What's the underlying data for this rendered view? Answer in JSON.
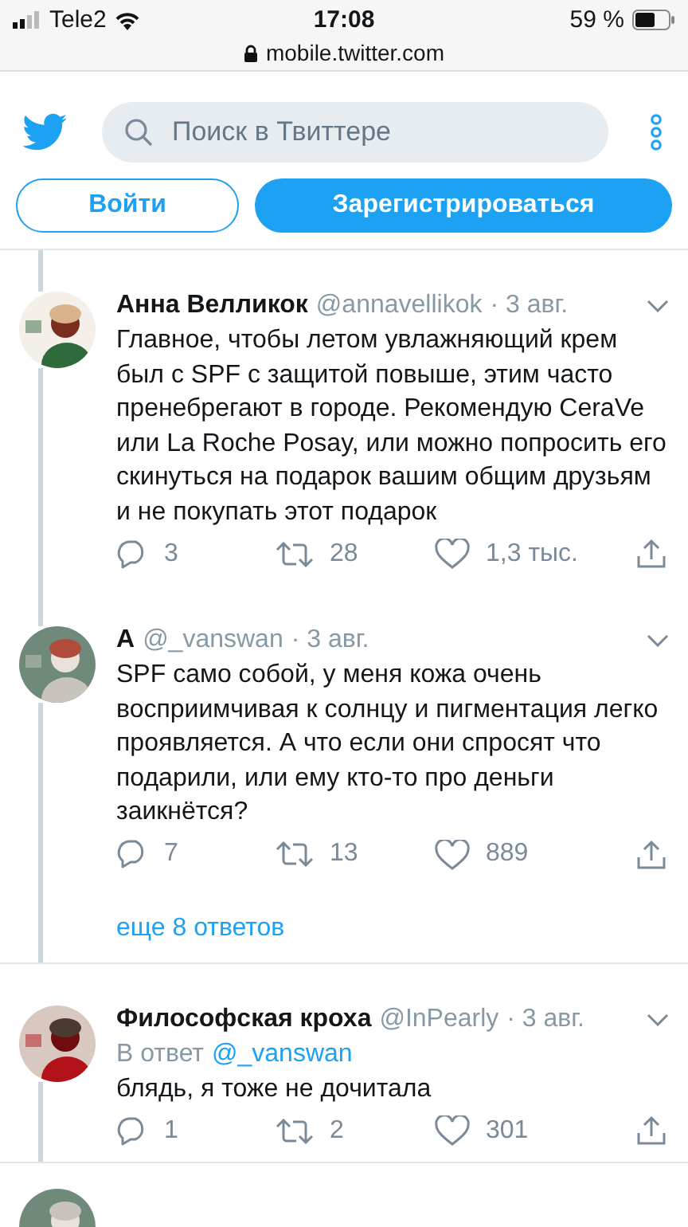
{
  "status_bar": {
    "carrier": "Tele2",
    "time": "17:08",
    "battery": "59 %",
    "url": "mobile.twitter.com"
  },
  "search": {
    "placeholder": "Поиск в Твиттере"
  },
  "buttons": [
    {
      "label": "Войти",
      "kind": "outline"
    },
    {
      "label": "Зарегистрироваться",
      "kind": "filled"
    }
  ],
  "tweets": [
    {
      "name": "Анна Велликок",
      "handle": "@annavellikok",
      "date": "· 3 авг.",
      "text": "Главное, чтобы летом увлажняющий крем был с SPF с защитой повыше, этим часто пренебрегают в городе. Рекомендую CeraVe или La Roche Posay, или можно попросить его скинуться на подарок вашим общим друзьям и не покупать этот подарок",
      "replies": "3",
      "retweets": "28",
      "likes": "1,3 тыс."
    },
    {
      "name": "А",
      "handle": "@_vanswan",
      "date": "· 3 авг.",
      "text": "SPF само собой, у меня кожа очень восприимчивая к солнцу и пигментация легко проявляется. А что если они спросят что подарили, или ему кто-то про деньги заикнётся?",
      "replies": "7",
      "retweets": "13",
      "likes": "889",
      "more_replies": "еще 8 ответов"
    },
    {
      "name": "Философская кроха",
      "handle": "@InPearly",
      "date": "· 3 авг.",
      "reply_to": {
        "prefix": "В ответ",
        "handle": "@_vanswan"
      },
      "text": "блядь, я тоже не дочитала",
      "replies": "1",
      "retweets": "2",
      "likes": "301"
    }
  ]
}
